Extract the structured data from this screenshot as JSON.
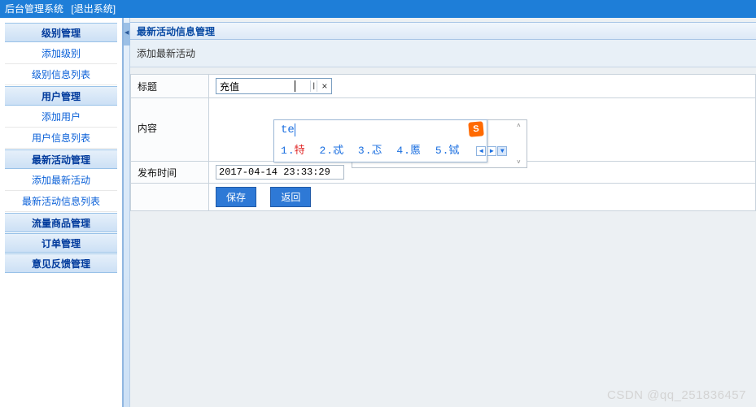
{
  "topbar": {
    "title": "后台管理系统",
    "logout": "[退出系统]"
  },
  "sidebar": {
    "groups": [
      {
        "header": "级别管理",
        "items": [
          "添加级别",
          "级别信息列表"
        ]
      },
      {
        "header": "用户管理",
        "items": [
          "添加用户",
          "用户信息列表"
        ]
      },
      {
        "header": "最新活动管理",
        "items": [
          "添加最新活动",
          "最新活动信息列表"
        ]
      },
      {
        "header": "流量商品管理",
        "items": []
      },
      {
        "header": "订单管理",
        "items": []
      },
      {
        "header": "意见反馈管理",
        "items": []
      }
    ]
  },
  "main": {
    "panel_title": "最新活动信息管理",
    "subtitle": "添加最新活动",
    "form": {
      "labels": {
        "title": "标题",
        "content": "内容",
        "publish_time": "发布时间"
      },
      "values": {
        "title": "充值",
        "publish_time": "2017-04-14 23:33:29"
      },
      "buttons": {
        "save": "保存",
        "back": "返回"
      },
      "clear_symbol": "×",
      "caret_symbol": "I"
    }
  },
  "ime": {
    "input": "te",
    "logo": "S",
    "candidates": [
      {
        "n": "1",
        "ch": "特"
      },
      {
        "n": "2",
        "ch": "忒"
      },
      {
        "n": "3",
        "ch": "忑"
      },
      {
        "n": "4",
        "ch": "慝"
      },
      {
        "n": "5",
        "ch": "铽"
      }
    ],
    "pager": {
      "prev": "◀",
      "next": "▶",
      "dd": "▼"
    }
  },
  "textarea_arrows": {
    "up": "˄",
    "down": "˅"
  },
  "watermark": "CSDN @qq_251836457"
}
